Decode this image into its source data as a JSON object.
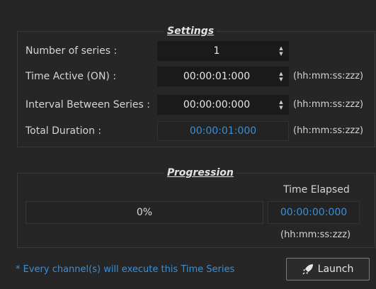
{
  "settings": {
    "title": "Settings",
    "rows": [
      {
        "label": "Number of series :",
        "value": "1",
        "unit": ""
      },
      {
        "label": "Time Active (ON) :",
        "value": "00:00:01:000",
        "unit": "(hh:mm:ss:zzz)"
      },
      {
        "label": "Interval Between Series :",
        "value": "00:00:00:000",
        "unit": "(hh:mm:ss:zzz)"
      }
    ],
    "total": {
      "label": "Total Duration :",
      "value": "00:00:01:000",
      "unit": "(hh:mm:ss:zzz)"
    }
  },
  "progression": {
    "title": "Progression",
    "percent_text": "0%",
    "time_elapsed_label": "Time Elapsed",
    "time_elapsed_value": "00:00:00:000",
    "unit": "(hh:mm:ss:zzz)"
  },
  "footer": {
    "note": "* Every channel(s) will execute this Time Series",
    "launch_label": "Launch"
  },
  "colors": {
    "accent": "#3a8fd6",
    "background": "#262626",
    "field": "#1a1a1a"
  },
  "icons": {
    "launch": "rocket-icon",
    "spin_up": "arrow-up-icon",
    "spin_down": "arrow-down-icon"
  }
}
